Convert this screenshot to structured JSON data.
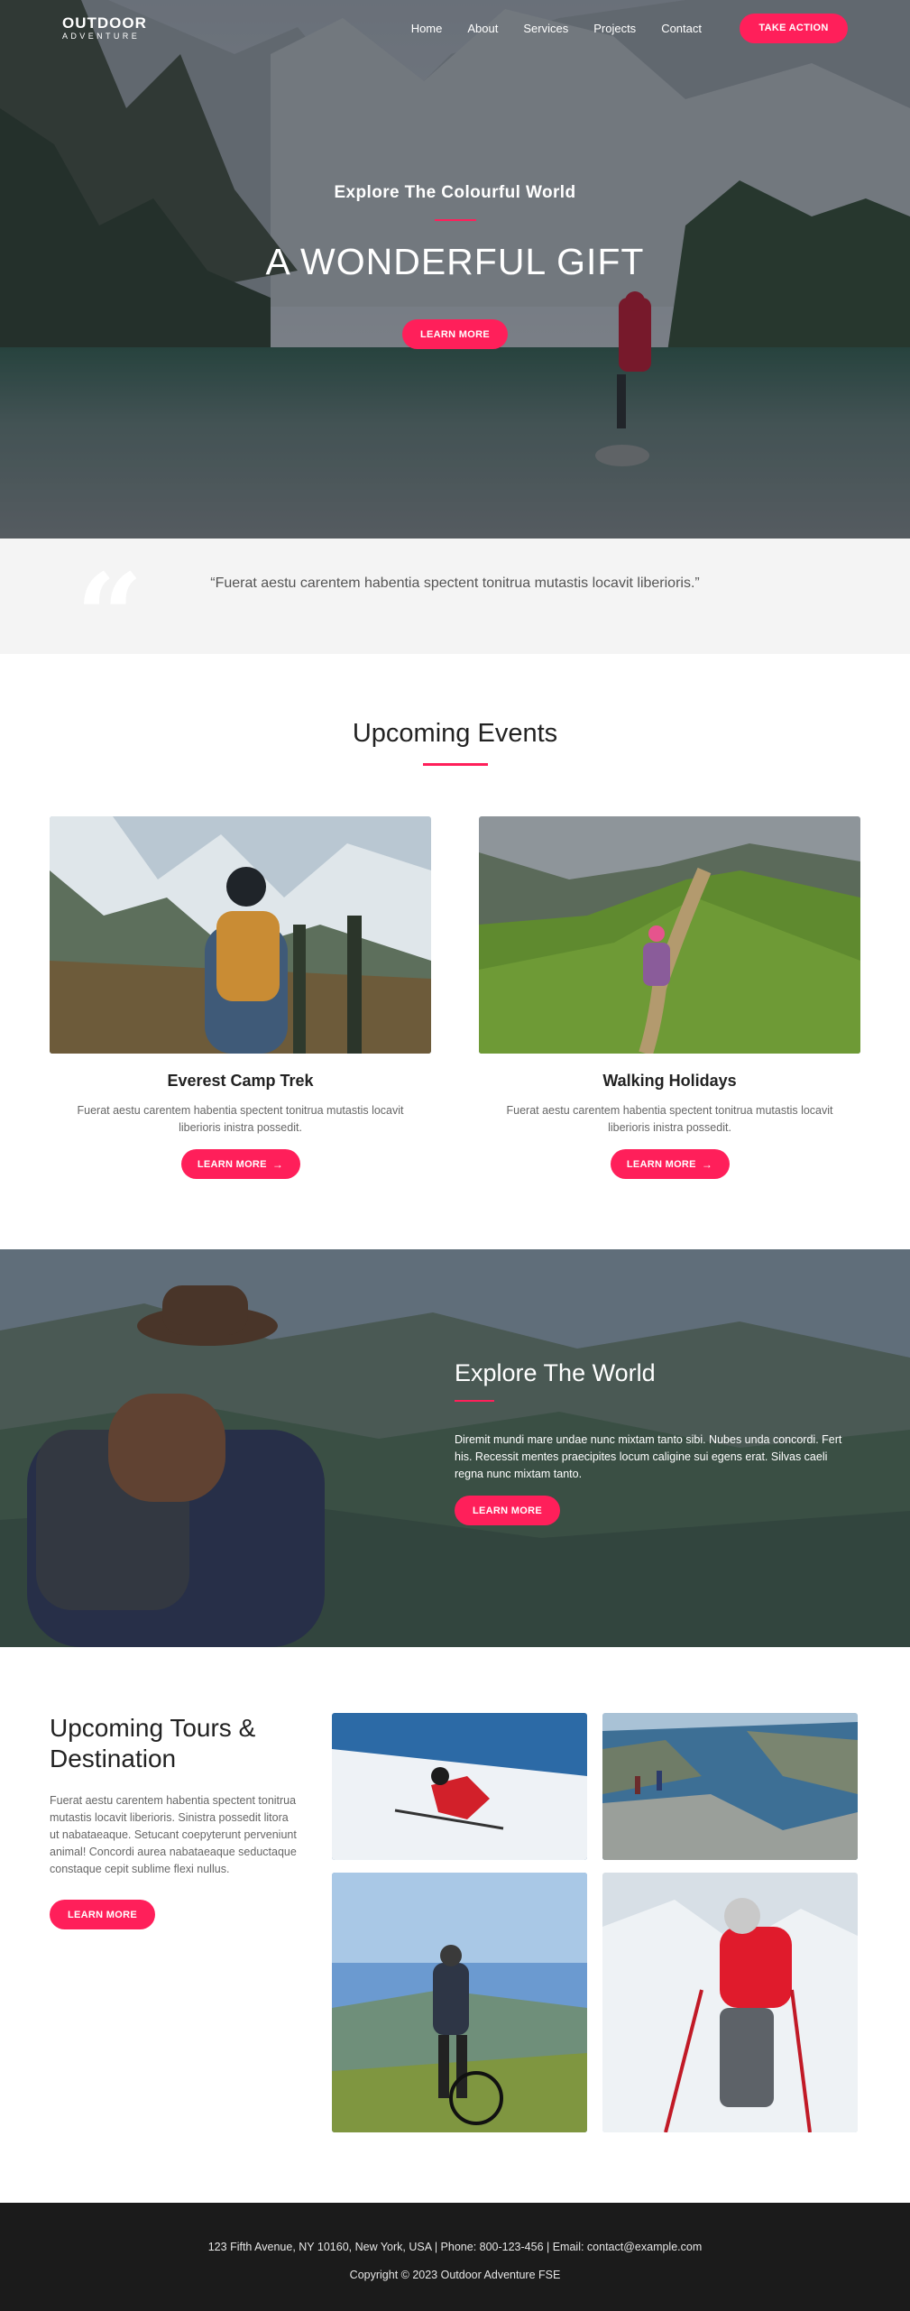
{
  "header": {
    "logo_top": "OUTDOOR",
    "logo_bottom": "ADVENTURE",
    "nav": [
      "Home",
      "About",
      "Services",
      "Projects",
      "Contact"
    ],
    "cta_label": "TAKE ACTION"
  },
  "hero": {
    "subtitle": "Explore The Colourful World",
    "title": "A WONDERFUL GIFT",
    "button_label": "LEARN MORE"
  },
  "quote": {
    "mark": "“",
    "text": "“Fuerat aestu carentem habentia spectent tonitrua mutastis locavit liberioris.”"
  },
  "events": {
    "title": "Upcoming Events",
    "cards": [
      {
        "title": "Everest Camp Trek",
        "text": "Fuerat aestu carentem habentia spectent tonitrua mutastis locavit liberioris inistra possedit.",
        "button_label": "LEARN MORE",
        "arrow": "→"
      },
      {
        "title": "Walking Holidays",
        "text": "Fuerat aestu carentem habentia spectent tonitrua mutastis locavit liberioris inistra possedit.",
        "button_label": "LEARN MORE",
        "arrow": "→"
      }
    ]
  },
  "explore": {
    "title": "Explore The World",
    "text": "Diremit mundi mare undae nunc mixtam tanto sibi. Nubes unda concordi. Fert his. Recessit mentes praecipites locum caligine sui egens erat. Silvas caeli regna nunc mixtam tanto.",
    "button_label": "LEARN MORE"
  },
  "tours": {
    "title": "Upcoming Tours & Destination",
    "text": "Fuerat aestu carentem habentia spectent tonitrua mutastis locavit liberioris. Sinistra possedit litora ut nabataeaque. Setucant coepyterunt perveniunt animal! Concordi aurea nabataeaque seductaque constaque cepit sublime flexi nullus.",
    "button_label": "LEARN MORE"
  },
  "footer": {
    "contact": "123 Fifth Avenue, NY 10160, New York, USA | Phone: 800-123-456 | Email: contact@example.com",
    "copyright": "Copyright © 2023  Outdoor Adventure FSE"
  },
  "colors": {
    "accent": "#ff1f5a",
    "footer_bg": "#1b1b1b",
    "quote_bg": "#f4f4f4"
  }
}
